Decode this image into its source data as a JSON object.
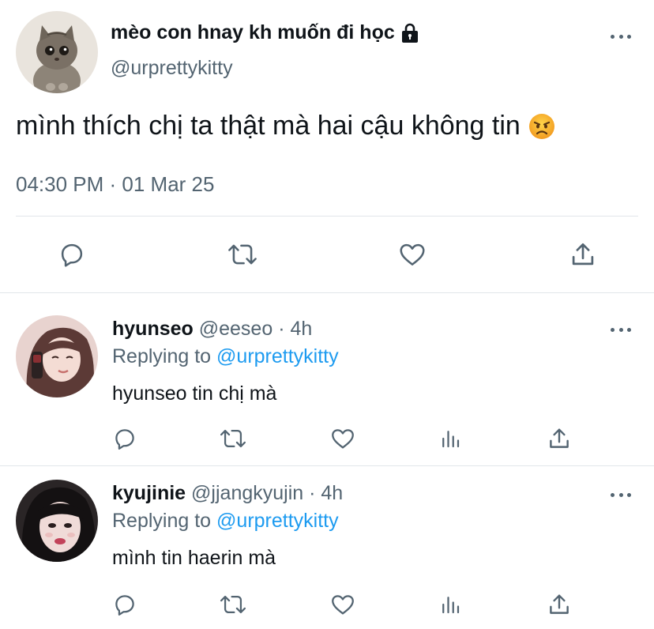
{
  "main_tweet": {
    "display_name": "mèo con hnay kh muốn đi học",
    "handle": "@urprettykitty",
    "text": "mình thích chị ta thật mà hai cậu không tin",
    "timestamp": "04:30 PM · 01 Mar 25",
    "locked_icon": "lock-icon",
    "text_emoji": "angry-face-emoji"
  },
  "replies": [
    {
      "display_name": "hyunseo",
      "meta": "@eeseo · 4h",
      "replying_prefix": "Replying to",
      "replying_handle": "@urprettykitty",
      "text": "hyunseo tin chị mà"
    },
    {
      "display_name": "kyujinie",
      "meta": "@jjangkyujin · 4h",
      "replying_prefix": "Replying to",
      "replying_handle": "@urprettykitty",
      "text": "mình tin haerin mà"
    }
  ],
  "colors": {
    "text": "#0f1419",
    "secondary": "#536471",
    "link": "#1d9bf0",
    "divider": "#e1e6ea"
  }
}
